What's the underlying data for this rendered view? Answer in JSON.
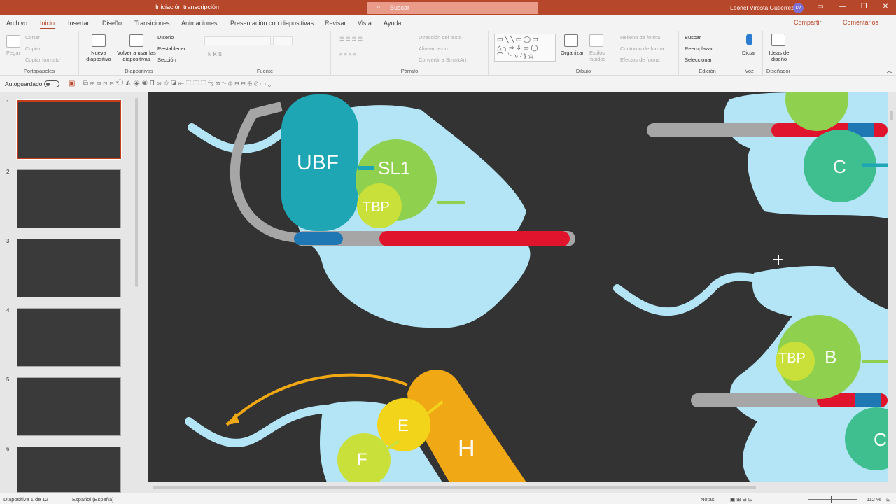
{
  "titlebar": {
    "doc_title": "Iniciación transcripción",
    "search_placeholder": "Buscar",
    "user_name": "Leonel Virosta Gutiérrez",
    "user_initials": "LV",
    "btn_restore": "▭",
    "btn_minimize": "—",
    "btn_maximize": "❐",
    "btn_close": "✕"
  },
  "menu": {
    "tabs": [
      "Archivo",
      "Inicio",
      "Insertar",
      "Diseño",
      "Transiciones",
      "Animaciones",
      "Presentación con diapositivas",
      "Revisar",
      "Vista",
      "Ayuda"
    ],
    "active": "Inicio",
    "share": "Compartir",
    "comments": "Comentarios"
  },
  "ribbon": {
    "portapapeles": {
      "label": "Portapapeles",
      "pegar": "Pegar",
      "cortar": "Cortar",
      "copiar": "Copiar",
      "copiar_formato": "Copiar formato"
    },
    "diapositivas": {
      "label": "Diapositivas",
      "nueva": "Nueva diapositiva",
      "reutilizar": "Volver a usar las diapositivas",
      "diseno": "Diseño",
      "restablecer": "Restablecer",
      "seccion": "Sección"
    },
    "fuente": {
      "label": "Fuente"
    },
    "parrafo": {
      "label": "Párrafo",
      "direccion": "Dirección del texto",
      "alinear": "Alinear texto",
      "smartart": "Convertir a SmartArt"
    },
    "dibujo": {
      "label": "Dibujo",
      "organizar": "Organizar",
      "estilos": "Estilos rápidos",
      "relleno": "Relleno de forma",
      "contorno": "Contorno de forma",
      "efectos": "Efectos de forma"
    },
    "edicion": {
      "label": "Edición",
      "buscar": "Buscar",
      "reemplazar": "Reemplazar",
      "seleccionar": "Seleccionar"
    },
    "voz": {
      "label": "Voz",
      "dictar": "Dictar"
    },
    "disenador": {
      "label": "Diseñador",
      "ideas": "Ideas de diseño"
    }
  },
  "qat": {
    "autoguardado": "Autoguardado"
  },
  "thumbnails": [
    "1",
    "2",
    "3",
    "4",
    "5",
    "6"
  ],
  "slide": {
    "labels": {
      "ubf": "UBF",
      "sl1": "SL1",
      "tbp": "TBP",
      "c": "C",
      "b": "B",
      "e": "E",
      "f": "F",
      "h": "H"
    },
    "colors": {
      "background": "#333333",
      "cloud": "#b3e5f7",
      "dna_gray": "#a6a6a6",
      "promoter_red": "#e0142c",
      "ubf": "#1fa6b4",
      "sl1": "#8fd14f",
      "tbp": "#c9e03a",
      "c_green": "#3fbf8f",
      "orange": "#f0a814",
      "yellow": "#f2d51a"
    }
  },
  "status": {
    "slide_info": "Diapositiva 1 de 12",
    "language": "Español (España)",
    "notes": "Notas",
    "zoom": "112 %"
  }
}
